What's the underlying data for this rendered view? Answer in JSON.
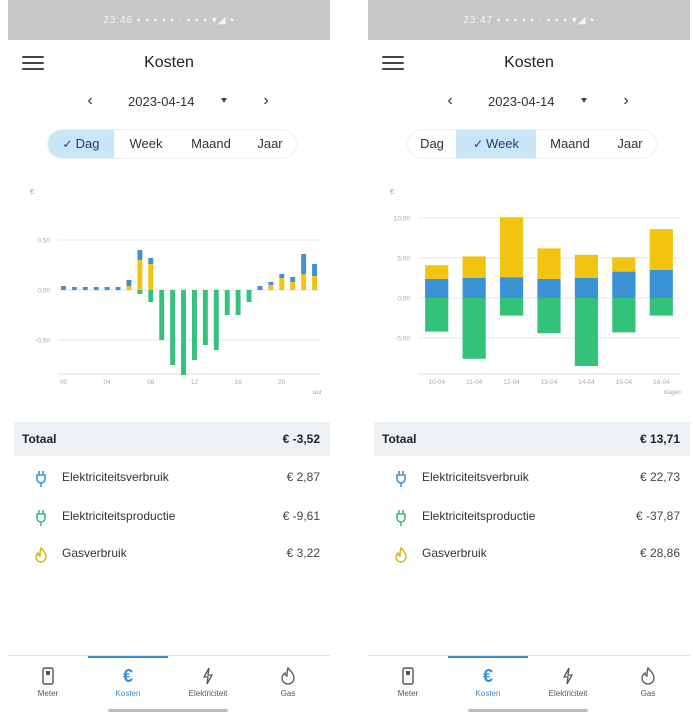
{
  "colors": {
    "usage": "#f1c40f",
    "gas": "#3b93d6",
    "production": "#34c27a",
    "accent": "#3a8fd6",
    "selected_segment": "#c9e6f7"
  },
  "screens": [
    {
      "status_text": "23:46 ▪ ▪ ▪ ▪ ▪ ·   ▪ ▪ ▪ ▾◢ ▪",
      "app_title": "Kosten",
      "date": "2023-04-14",
      "nav_prev_icon": "chevron-left",
      "nav_next_icon": "chevron-right",
      "menu_icon": "hamburger-menu",
      "periods": [
        {
          "label": "Dag",
          "selected": true
        },
        {
          "label": "Week",
          "selected": false
        },
        {
          "label": "Maand",
          "selected": false
        },
        {
          "label": "Jaar",
          "selected": false
        }
      ],
      "total": {
        "label": "Totaal",
        "value": "€ -3,52"
      },
      "items": [
        {
          "label": "Elektriciteitsverbruik",
          "value": "€ 2,87",
          "icon": "plug-icon"
        },
        {
          "label": "Elektriciteitsproductie",
          "value": "€ -9,61",
          "icon": "plug-icon"
        },
        {
          "label": "Gasverbruik",
          "value": "€ 3,22",
          "icon": "flame-icon"
        }
      ],
      "bottom_nav": [
        {
          "label": "Meter",
          "icon": "meter-icon",
          "active": false
        },
        {
          "label": "Kosten",
          "icon": "euro-icon",
          "active": true
        },
        {
          "label": "Elektriciteit",
          "icon": "bolt-icon",
          "active": false
        },
        {
          "label": "Gas",
          "icon": "flame-icon",
          "active": false
        }
      ]
    },
    {
      "status_text": "23:47 ▪ ▪ ▪ ▪ ▪ ·   ▪ ▪ ▪ ▾◢ ▪",
      "app_title": "Kosten",
      "date": "2023-04-14",
      "nav_prev_icon": "chevron-left",
      "nav_next_icon": "chevron-right",
      "menu_icon": "hamburger-menu",
      "periods": [
        {
          "label": "Dag",
          "selected": false
        },
        {
          "label": "Week",
          "selected": true
        },
        {
          "label": "Maand",
          "selected": false
        },
        {
          "label": "Jaar",
          "selected": false
        }
      ],
      "total": {
        "label": "Totaal",
        "value": "€ 13,71"
      },
      "items": [
        {
          "label": "Elektriciteitsverbruik",
          "value": "€ 22,73",
          "icon": "plug-icon"
        },
        {
          "label": "Elektriciteitsproductie",
          "value": "€ -37,87",
          "icon": "plug-icon"
        },
        {
          "label": "Gasverbruik",
          "value": "€ 28,86",
          "icon": "flame-icon"
        }
      ],
      "bottom_nav": [
        {
          "label": "Meter",
          "icon": "meter-icon",
          "active": false
        },
        {
          "label": "Kosten",
          "icon": "euro-icon",
          "active": true
        },
        {
          "label": "Elektriciteit",
          "icon": "bolt-icon",
          "active": false
        },
        {
          "label": "Gas",
          "icon": "flame-icon",
          "active": false
        }
      ]
    }
  ],
  "chart_data": [
    {
      "type": "bar",
      "stacked": true,
      "ylabel": "€",
      "xlabel": "uur",
      "yticks": [
        "0,50",
        "0,00",
        "-0,50"
      ],
      "ylim": [
        -0.8,
        0.8
      ],
      "xtick_labels": [
        "00",
        "04",
        "08",
        "12",
        "16",
        "20"
      ],
      "x": [
        0,
        1,
        2,
        3,
        4,
        5,
        6,
        7,
        8,
        9,
        10,
        11,
        12,
        13,
        14,
        15,
        16,
        17,
        18,
        19,
        20,
        21,
        22,
        23
      ],
      "series": [
        {
          "name": "Elektriciteitsverbruik",
          "values": [
            0,
            0,
            0,
            0,
            0,
            0,
            0.04,
            0.3,
            0.26,
            0,
            0,
            0,
            0,
            0,
            0,
            0,
            0,
            0,
            0,
            0.05,
            0.12,
            0.08,
            0.16,
            0.14
          ]
        },
        {
          "name": "Gasverbruik",
          "values": [
            0.04,
            0.03,
            0.03,
            0.03,
            0.03,
            0.03,
            0.06,
            0.1,
            0.06,
            0,
            0,
            0,
            0,
            0,
            0,
            0,
            0,
            0,
            0.04,
            0.03,
            0.04,
            0.05,
            0.2,
            0.12
          ]
        },
        {
          "name": "Elektriciteitsproductie",
          "values": [
            0,
            0,
            0,
            0,
            0,
            0,
            0,
            -0.04,
            -0.12,
            -0.5,
            -0.75,
            -0.85,
            -0.7,
            -0.55,
            -0.6,
            -0.25,
            -0.25,
            -0.12,
            0,
            0,
            0,
            0,
            0,
            0
          ]
        }
      ]
    },
    {
      "type": "bar",
      "stacked": true,
      "ylabel": "€",
      "xlabel": "dagen",
      "yticks": [
        "10,00",
        "5,00",
        "0,00",
        "-5,00"
      ],
      "ylim": [
        -9,
        11
      ],
      "categories": [
        "10-04",
        "11-04",
        "12-04",
        "13-04",
        "14-04",
        "15-04",
        "16-04"
      ],
      "series": [
        {
          "name": "Gasverbruik",
          "values": [
            2.4,
            2.5,
            2.6,
            2.4,
            2.5,
            3.3,
            3.5
          ]
        },
        {
          "name": "Elektriciteitsverbruik",
          "values": [
            1.7,
            2.7,
            7.5,
            3.8,
            2.9,
            1.8,
            5.1
          ]
        },
        {
          "name": "Elektriciteitsproductie",
          "values": [
            -4.2,
            -7.6,
            -2.2,
            -4.4,
            -8.5,
            -4.3,
            -2.2
          ]
        }
      ]
    }
  ]
}
